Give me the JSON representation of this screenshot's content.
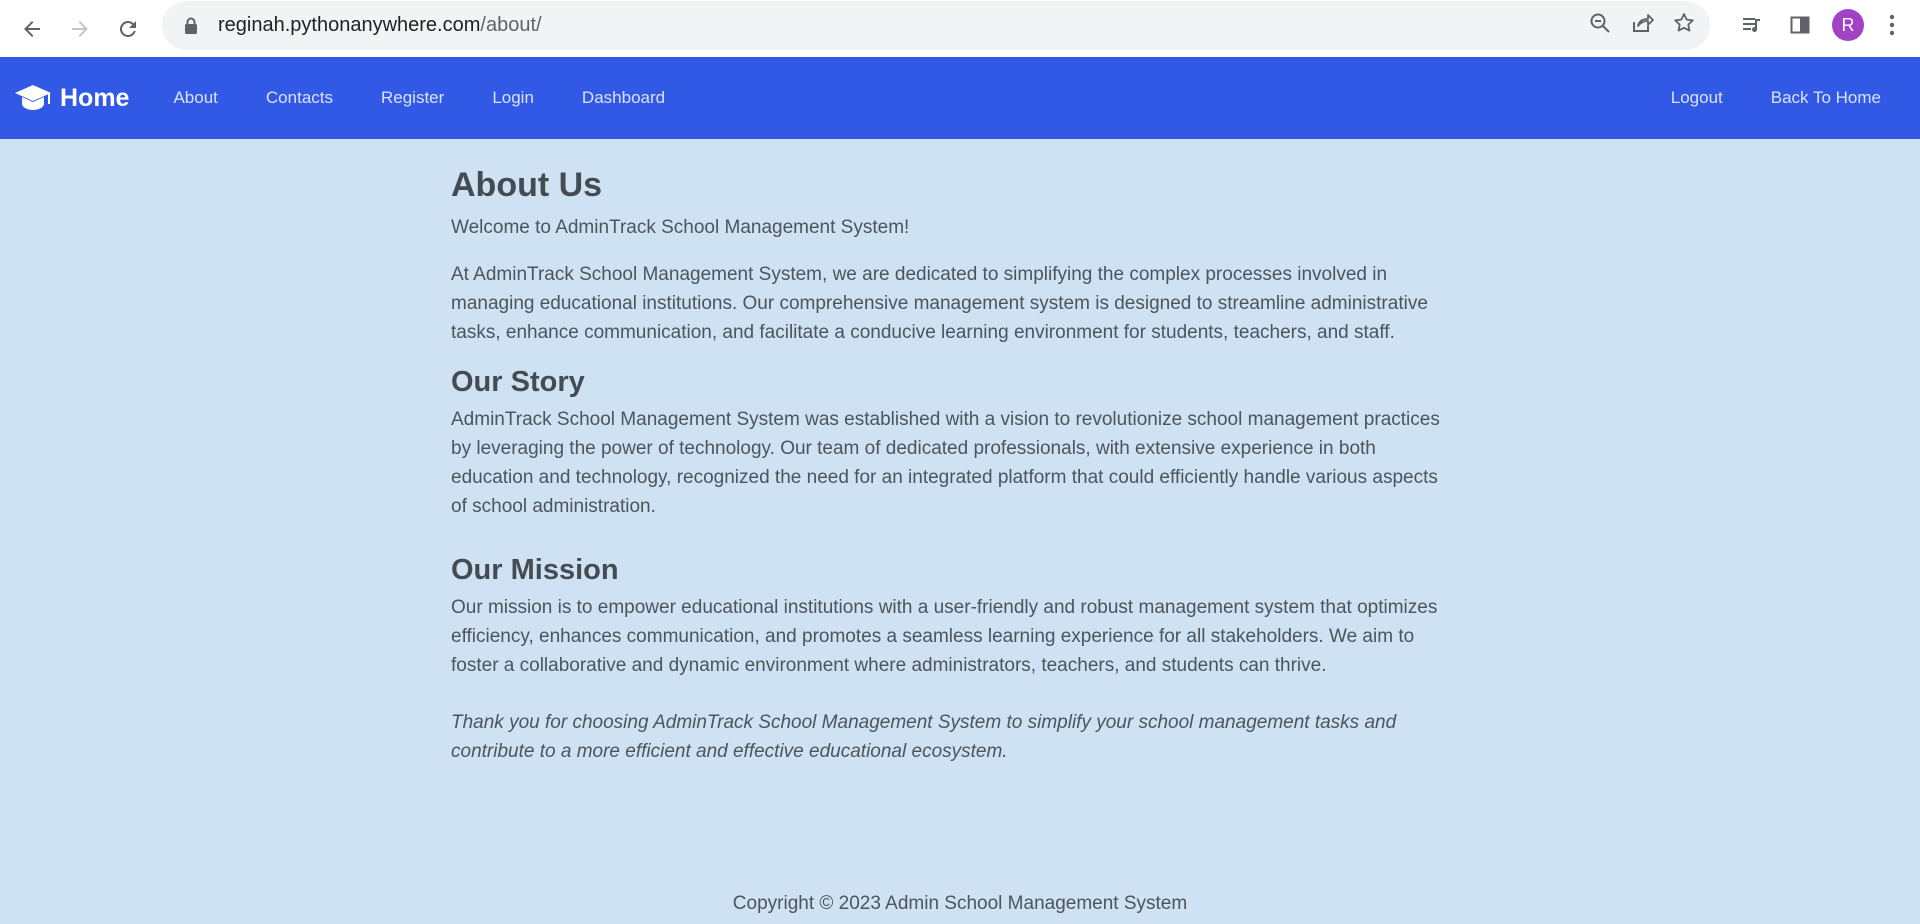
{
  "browser": {
    "url_host": "reginah.pythonanywhere.com",
    "url_path": "/about/",
    "avatar_letter": "R",
    "avatar_color": "#a142c5"
  },
  "navbar": {
    "brand": "Home",
    "links": [
      "About",
      "Contacts",
      "Register",
      "Login",
      "Dashboard"
    ],
    "right_links": [
      "Logout",
      "Back To Home"
    ],
    "bg_color": "#3259e6"
  },
  "about": {
    "title": "About Us",
    "welcome": "Welcome to AdminTrack School Management System!",
    "intro": "At AdminTrack School Management System, we are dedicated to simplifying the complex processes involved in managing educational institutions. Our comprehensive management system is designed to streamline administrative tasks, enhance communication, and facilitate a conducive learning environment for students, teachers, and staff.",
    "story_title": "Our Story",
    "story": "AdminTrack School Management System was established with a vision to revolutionize school management practices by leveraging the power of technology. Our team of dedicated professionals, with extensive experience in both education and technology, recognized the need for an integrated platform that could efficiently handle various aspects of school administration.",
    "mission_title": "Our Mission",
    "mission": "Our mission is to empower educational institutions with a user-friendly and robust management system that optimizes efficiency, enhances communication, and promotes a seamless learning experience for all stakeholders. We aim to foster a collaborative and dynamic environment where administrators, teachers, and students can thrive.",
    "thanks": "Thank you for choosing AdminTrack School Management System to simplify your school management tasks and contribute to a more efficient and effective educational ecosystem."
  },
  "footer": {
    "copyright": "Copyright © 2023 Admin School Management System"
  }
}
